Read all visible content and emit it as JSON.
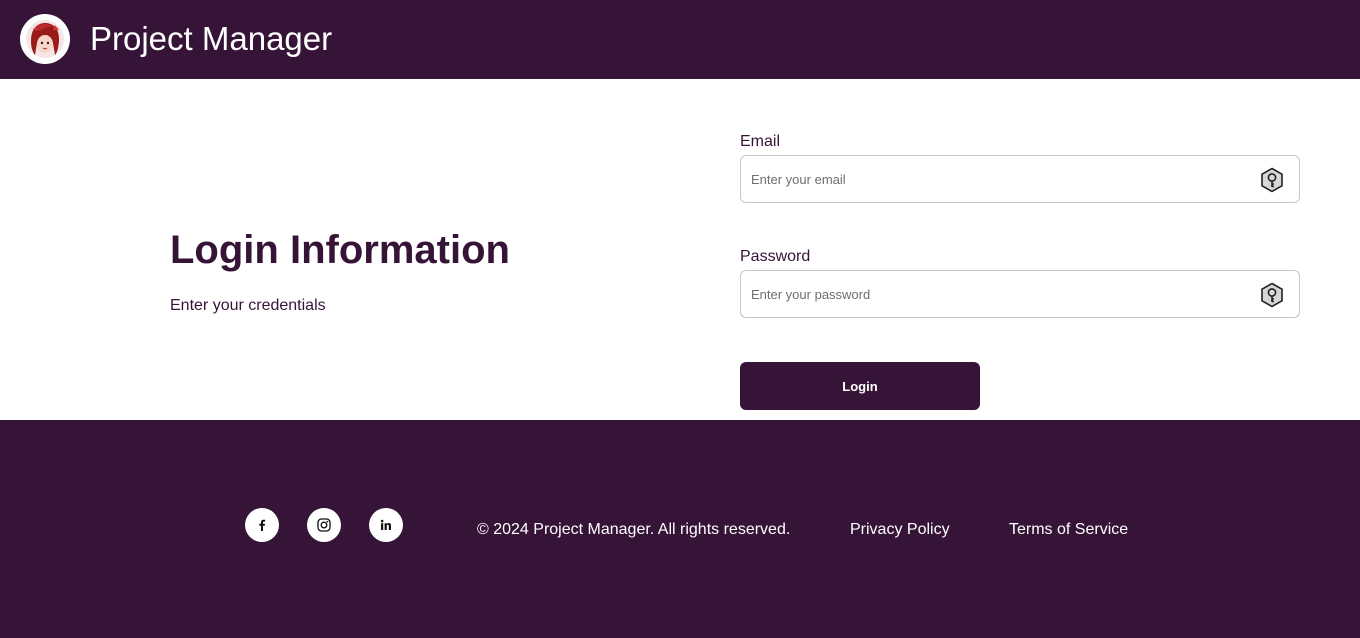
{
  "header": {
    "app_title": "Project Manager",
    "logo_icon": "avatar-logo-icon",
    "background": "#361437"
  },
  "main": {
    "heading": "Login Information",
    "subheading": "Enter your credentials",
    "email": {
      "label": "Email",
      "placeholder": "Enter your email",
      "value": "",
      "icon": "key-icon"
    },
    "password": {
      "label": "Password",
      "placeholder": "Enter your password",
      "value": "",
      "icon": "key-icon"
    },
    "login_button": "Login"
  },
  "footer": {
    "social": [
      {
        "icon": "facebook-icon"
      },
      {
        "icon": "instagram-icon"
      },
      {
        "icon": "linkedin-icon"
      }
    ],
    "copyright": "© 2024 Project Manager. All rights reserved.",
    "privacy_link": "Privacy Policy",
    "terms_link": "Terms of Service"
  },
  "colors": {
    "brand": "#361437",
    "surface": "#ffffff",
    "input_border": "#c9c4cc"
  }
}
